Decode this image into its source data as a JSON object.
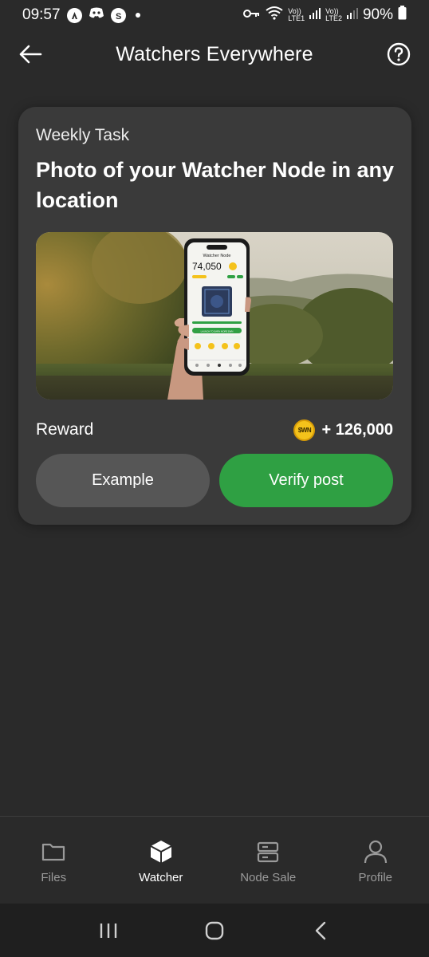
{
  "status_bar": {
    "time": "09:57",
    "network_1": "Vo))\nLTE1",
    "network_2": "Vo))\nLTE2",
    "battery": "90%"
  },
  "app_bar": {
    "title": "Watchers Everywhere",
    "back_icon": "arrow-left-icon",
    "help_icon": "question-circle-icon"
  },
  "task": {
    "subtitle": "Weekly Task",
    "title": "Photo of your Watcher Node in any location",
    "image": {
      "phone_header": "Watcher Node",
      "phone_balance": "74,050",
      "phone_cta": "LAUNCH TO EARN MORE $WN"
    },
    "reward_label": "Reward",
    "reward_coin": "$WN",
    "reward_value": "+ 126,000",
    "example_button": "Example",
    "verify_button": "Verify post"
  },
  "bottom_nav": {
    "items": [
      {
        "label": "Files",
        "icon": "folder-icon",
        "active": false
      },
      {
        "label": "Watcher",
        "icon": "cube-icon",
        "active": true
      },
      {
        "label": "Node Sale",
        "icon": "server-icon",
        "active": false
      },
      {
        "label": "Profile",
        "icon": "person-icon",
        "active": false
      }
    ]
  },
  "colors": {
    "background": "#2a2a2a",
    "card": "#3a3a3a",
    "accent_green": "#2fa043",
    "secondary_button": "#565656",
    "coin": "#f4c21b"
  }
}
